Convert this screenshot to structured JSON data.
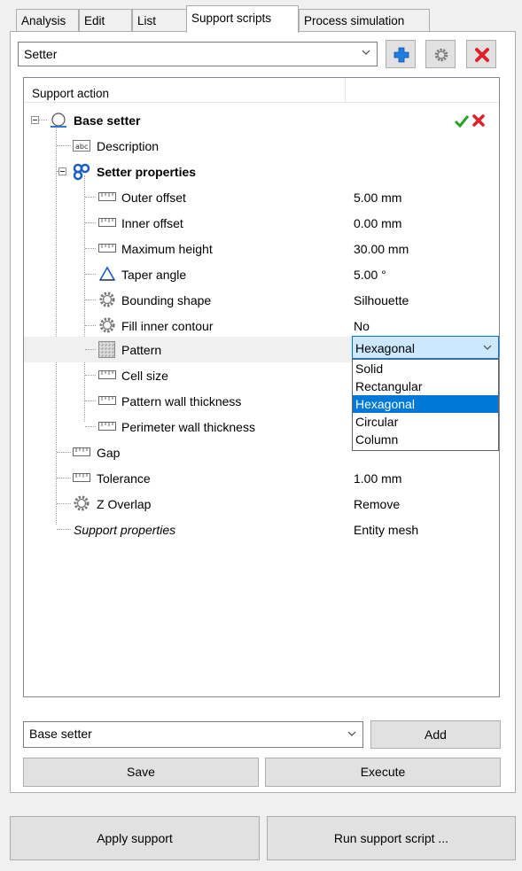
{
  "tabs": [
    {
      "label": "Analysis",
      "active": false
    },
    {
      "label": "Edit",
      "active": false
    },
    {
      "label": "List",
      "active": false
    },
    {
      "label": "Support scripts",
      "active": true
    },
    {
      "label": "Process simulation",
      "active": false
    }
  ],
  "script_selector": {
    "value": "Setter"
  },
  "tree": {
    "column_header": "Support action",
    "root": {
      "label": "Base setter",
      "status_ok": "check-icon",
      "status_remove": "remove-icon"
    },
    "description": {
      "label": "Description"
    },
    "setter_properties": {
      "label": "Setter properties",
      "items": [
        {
          "label": "Outer offset",
          "value": "5.00 mm",
          "icon": "ruler-icon"
        },
        {
          "label": "Inner offset",
          "value": "0.00 mm",
          "icon": "ruler-icon"
        },
        {
          "label": "Maximum height",
          "value": "30.00 mm",
          "icon": "ruler-icon"
        },
        {
          "label": "Taper angle",
          "value": "5.00 °",
          "icon": "angle-icon"
        },
        {
          "label": "Bounding shape",
          "value": "Silhouette",
          "icon": "gear-icon"
        },
        {
          "label": "Fill inner contour",
          "value": "No",
          "icon": "gear-icon"
        },
        {
          "label": "Pattern",
          "value": "Hexagonal",
          "icon": "pattern-icon"
        },
        {
          "label": "Cell size",
          "value": "",
          "icon": "ruler-icon"
        },
        {
          "label": "Pattern wall thickness",
          "value": "",
          "icon": "ruler-icon"
        },
        {
          "label": "Perimeter wall thickness",
          "value": "",
          "icon": "ruler-icon"
        }
      ]
    },
    "base_items": [
      {
        "label": "Gap",
        "value": "",
        "icon": "ruler-icon"
      },
      {
        "label": "Tolerance",
        "value": "1.00 mm",
        "icon": "ruler-icon"
      },
      {
        "label": "Z Overlap",
        "value": "Remove",
        "icon": "gear-icon"
      }
    ],
    "support_properties": {
      "label": "Support properties",
      "value": "Entity mesh"
    }
  },
  "pattern_dropdown": {
    "selected": "Hexagonal",
    "options": [
      "Solid",
      "Rectangular",
      "Hexagonal",
      "Circular",
      "Column"
    ]
  },
  "action_selector": {
    "value": "Base setter"
  },
  "buttons": {
    "add": "Add",
    "save": "Save",
    "execute": "Execute",
    "apply_support": "Apply support",
    "run_support_script": "Run support script ..."
  },
  "colors": {
    "accent": "#0078d7",
    "add_blue": "#1e7fe0",
    "remove_red": "#e0202a",
    "ok_green": "#2aa22a",
    "icon_blue": "#1a5cc8"
  }
}
